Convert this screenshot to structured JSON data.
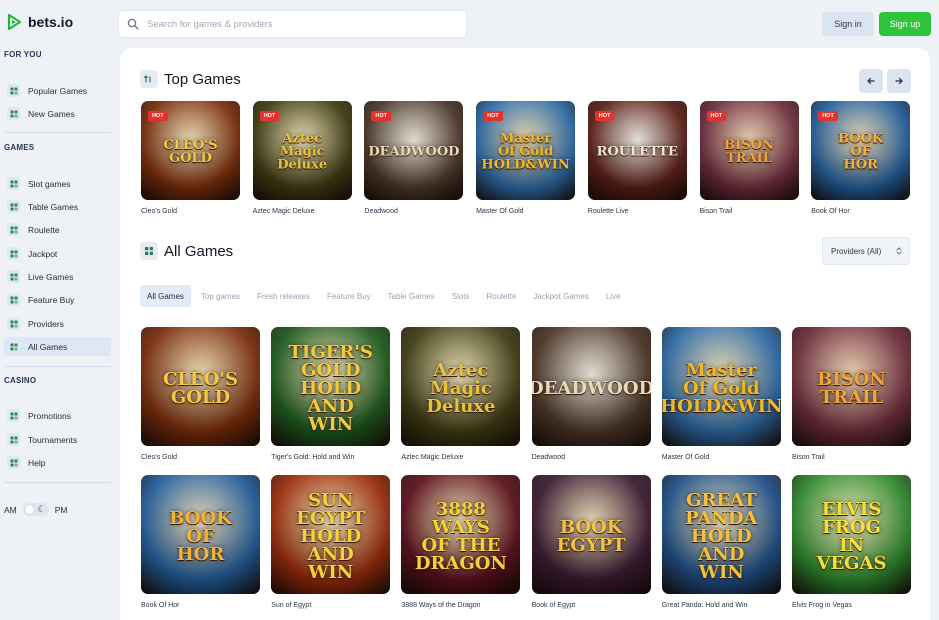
{
  "brand": {
    "name": "bets.io"
  },
  "search": {
    "placeholder": "Search for games & providers"
  },
  "auth": {
    "signin": "Sign in",
    "signup": "Sign up"
  },
  "sidebar": {
    "sections": [
      {
        "title": "FOR YOU",
        "items": [
          {
            "label": "Popular Games",
            "icon": "trophy-icon"
          },
          {
            "label": "New Games",
            "icon": "grid-icon"
          }
        ]
      },
      {
        "title": "GAMES",
        "items": [
          {
            "label": "Slot games",
            "icon": "slot-icon"
          },
          {
            "label": "Table Games",
            "icon": "cards-icon"
          },
          {
            "label": "Roulette",
            "icon": "roulette-icon"
          },
          {
            "label": "Jackpot",
            "icon": "jackpot-icon"
          },
          {
            "label": "Live Games",
            "icon": "live-icon"
          },
          {
            "label": "Feature Buy",
            "icon": "feature-buy-icon"
          },
          {
            "label": "Providers",
            "icon": "providers-icon"
          },
          {
            "label": "All Games",
            "icon": "grid-icon"
          }
        ]
      },
      {
        "title": "CASINO",
        "items": [
          {
            "label": "Promotions",
            "icon": "gift-icon"
          },
          {
            "label": "Tournaments",
            "icon": "cup-icon"
          },
          {
            "label": "Help",
            "icon": "help-icon"
          }
        ]
      }
    ],
    "active": "All Games",
    "theme_toggle": {
      "left": "AM",
      "right": "PM"
    }
  },
  "top_games": {
    "title": "Top Games",
    "badge": "HOT",
    "items": [
      {
        "name": "Cleo's Gold",
        "art": "CLEO'S GOLD",
        "hot": true,
        "bg": "#7a2a08",
        "accent": "#f6c744"
      },
      {
        "name": "Aztec Magic Deluxe",
        "art": "Aztec\nMagic\nDeluxe",
        "hot": true,
        "bg": "#3d3a10",
        "accent": "#e8c33a"
      },
      {
        "name": "Deadwood",
        "art": "DEADWOOD",
        "hot": true,
        "bg": "#4a3426",
        "accent": "#e9d9b5"
      },
      {
        "name": "Master Of Gold",
        "art": "Master\nOf Gold\nHOLD&WIN",
        "hot": true,
        "bg": "#2b6aa8",
        "accent": "#f1b82a"
      },
      {
        "name": "Roulette Live",
        "art": "ROULETTE",
        "hot": true,
        "bg": "#5a1c14",
        "accent": "#f3e7d2"
      },
      {
        "name": "Bison Trail",
        "art": "BISON\nTRAIL",
        "hot": true,
        "bg": "#6d2a3a",
        "accent": "#f2a33a"
      },
      {
        "name": "Book Of Hor",
        "art": "BOOK OF HOR",
        "hot": true,
        "bg": "#1f5d9c",
        "accent": "#f3b33a"
      }
    ]
  },
  "all_games": {
    "title": "All Games",
    "providers_label": "Providers (All)",
    "tabs": [
      "All Games",
      "Top games",
      "Fresh releases",
      "Feature Buy",
      "Table Games",
      "Slots",
      "Roulette",
      "Jackpot Games",
      "Live"
    ],
    "active_tab": "All Games",
    "rows": [
      [
        {
          "name": "Cleo's Gold",
          "art": "CLEO'S GOLD",
          "bg": "#7a2a08",
          "accent": "#f6c744"
        },
        {
          "name": "Tiger's Gold: Hold and Win",
          "art": "TIGER'S\nGOLD\nHOLD AND WIN",
          "bg": "#1c5a1c",
          "accent": "#f5c93c"
        },
        {
          "name": "Aztec Magic Deluxe",
          "art": "Aztec\nMagic\nDeluxe",
          "bg": "#3d3a10",
          "accent": "#e8c33a"
        },
        {
          "name": "Deadwood",
          "art": "DEADWOOD",
          "bg": "#4a3426",
          "accent": "#e9d9b5"
        },
        {
          "name": "Master Of Gold",
          "art": "Master\nOf Gold\nHOLD&WIN",
          "bg": "#2b6aa8",
          "accent": "#f1b82a"
        },
        {
          "name": "Bison Trail",
          "art": "BISON\nTRAIL",
          "bg": "#6d2a3a",
          "accent": "#f2a33a"
        }
      ],
      [
        {
          "name": "Book Of Hor",
          "art": "BOOK OF HOR",
          "bg": "#1f5d9c",
          "accent": "#f3b33a"
        },
        {
          "name": "Sun of Egypt",
          "art": "SUN\nEGYPT\nHOLD AND WIN",
          "bg": "#9c2a08",
          "accent": "#f6d23a"
        },
        {
          "name": "3888 Ways of the Dragon",
          "art": "3888\nWAYS\nOF THE\nDRAGON",
          "bg": "#5a0c18",
          "accent": "#f6cf3a"
        },
        {
          "name": "Book of Egypt",
          "art": "BOOK\nEGYPT",
          "bg": "#3a1830",
          "accent": "#f3c246"
        },
        {
          "name": "Great Panda: Hold and Win",
          "art": "GREAT\nPANDA\nHOLD AND WIN",
          "bg": "#1d4f8a",
          "accent": "#f4c23a"
        },
        {
          "name": "Elvis Frog in Vegas",
          "art": "ELVIS FROG\nIN VEGAS",
          "bg": "#2c8a2c",
          "accent": "#f6df3a"
        }
      ]
    ]
  }
}
